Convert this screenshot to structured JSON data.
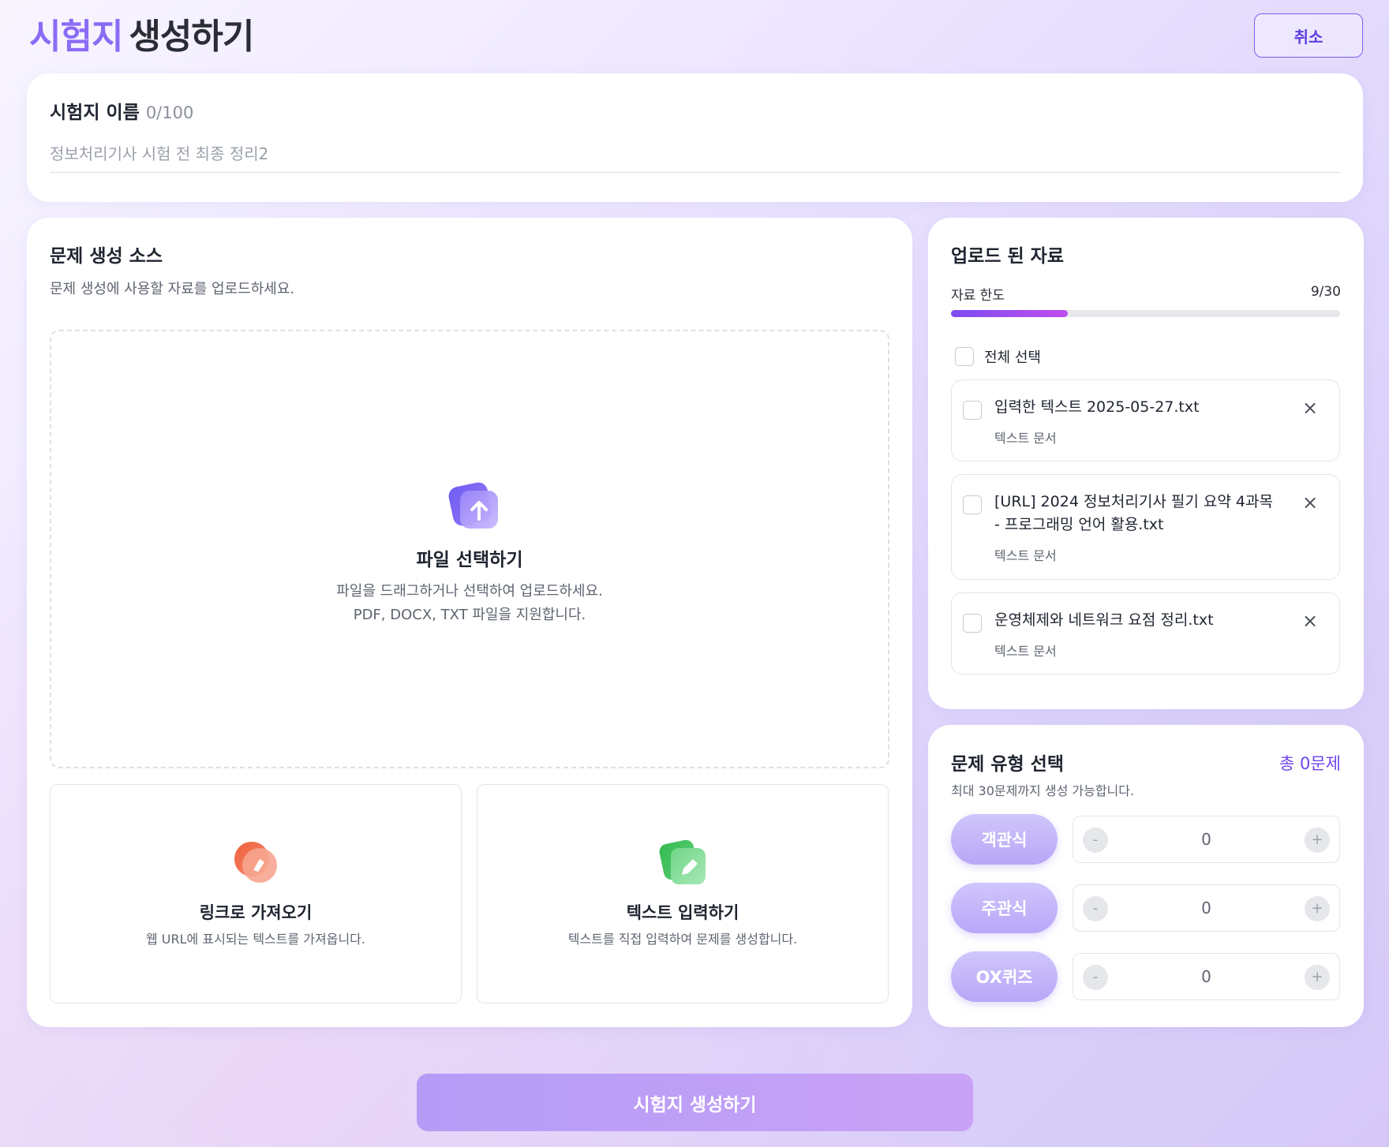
{
  "header": {
    "title_accent": "시험지",
    "title_rest": "생성하기",
    "cancel_label": "취소"
  },
  "exam_name": {
    "label": "시험지 이름",
    "count": "0/100",
    "placeholder": "정보처리기사 시험 전 최종 정리2",
    "value": ""
  },
  "source": {
    "title": "문제 생성 소스",
    "subtitle": "문제 생성에 사용할 자료를 업로드하세요.",
    "dropzone": {
      "icon": "upload-icon",
      "title": "파일 선택하기",
      "desc_line1": "파일을 드래그하거나 선택하여 업로드하세요.",
      "desc_line2": "PDF, DOCX, TXT 파일을 지원합니다."
    },
    "options": [
      {
        "icon": "link-icon",
        "title": "링크로 가져오기",
        "desc": "웹 URL에 표시되는 텍스트를 가져옵니다."
      },
      {
        "icon": "pencil-icon",
        "title": "텍스트 입력하기",
        "desc": "텍스트를 직접 입력하여 문제를 생성합니다."
      }
    ]
  },
  "uploaded": {
    "title": "업로드 된 자료",
    "limit_label": "자료 한도",
    "limit_count": "9/30",
    "limit_fraction": 0.3,
    "select_all_label": "전체 선택",
    "files": [
      {
        "name": "입력한 텍스트 2025-05-27.txt",
        "type": "텍스트 문서"
      },
      {
        "name": "[URL] 2024 정보처리기사 필기 요약 4과목 - 프로그래밍 언어 활용.txt",
        "type": "텍스트 문서"
      },
      {
        "name": "운영체제와 네트워크 요점 정리.txt",
        "type": "텍스트 문서"
      }
    ]
  },
  "question_types": {
    "title": "문제 유형 선택",
    "total": "총 0문제",
    "subtitle": "최대 30문제까지 생성 가능합니다.",
    "types": [
      {
        "label": "객관식",
        "value": "0"
      },
      {
        "label": "주관식",
        "value": "0"
      },
      {
        "label": "OX퀴즈",
        "value": "0"
      }
    ],
    "minus_label": "-",
    "plus_label": "+"
  },
  "generate_label": "시험지 생성하기",
  "colors": {
    "accent": "#8b6cf5",
    "cancel_border": "#7c5ff0",
    "progress_start": "#7c4df0",
    "progress_end": "#c04df0",
    "pill": "#c4b5fa",
    "generate_button": "#bea0f6"
  }
}
